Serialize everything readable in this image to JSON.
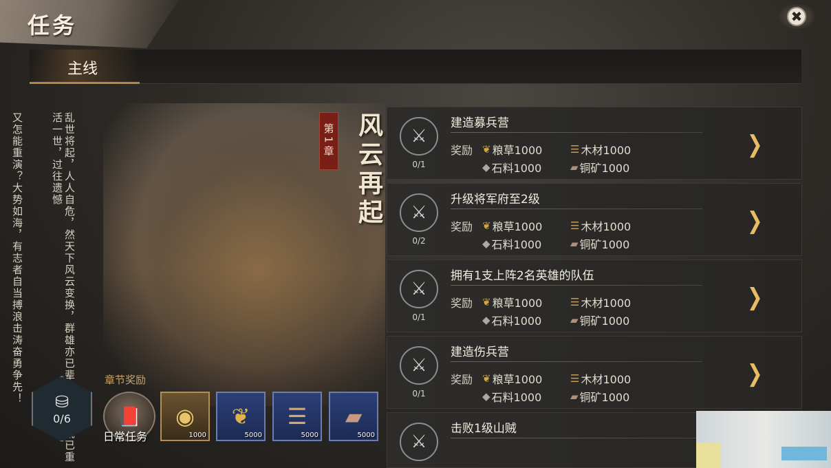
{
  "header": {
    "title": "任务",
    "close_label": "✖"
  },
  "tabs": [
    {
      "label": "主线",
      "active": true
    }
  ],
  "story": {
    "col1": "乱世将起，人人自危，然天下风云变换，群雄亦已辈出，而今既已重活一世，过往遗憾",
    "col2": "又怎能重演？大势如海，有志者自当搏浪击涛奋勇争先！"
  },
  "chapter": {
    "tag": "第1章",
    "title": "风云再起"
  },
  "progress": {
    "value": "0/6"
  },
  "chapter_rewards": {
    "label": "章节奖励",
    "daily_label": "日常任务",
    "items": [
      {
        "icon": "gold-coin-icon",
        "amount": "1000"
      },
      {
        "icon": "grain-icon",
        "amount": "5000"
      },
      {
        "icon": "wood-icon",
        "amount": "5000"
      },
      {
        "icon": "copper-ingot-icon",
        "amount": "5000"
      }
    ]
  },
  "quests": [
    {
      "title": "建造募兵营",
      "progress": "0/1",
      "reward_label": "奖励",
      "rewards": [
        "粮草1000",
        "木材1000",
        "石料1000",
        "铜矿1000"
      ]
    },
    {
      "title": "升级将军府至2级",
      "progress": "0/2",
      "reward_label": "奖励",
      "rewards": [
        "粮草1000",
        "木材1000",
        "石料1000",
        "铜矿1000"
      ]
    },
    {
      "title": "拥有1支上阵2名英雄的队伍",
      "progress": "0/1",
      "reward_label": "奖励",
      "rewards": [
        "粮草1000",
        "木材1000",
        "石料1000",
        "铜矿1000"
      ]
    },
    {
      "title": "建造伤兵营",
      "progress": "0/1",
      "reward_label": "奖励",
      "rewards": [
        "粮草1000",
        "木材1000",
        "石料1000",
        "铜矿1000"
      ]
    },
    {
      "title": "击败1级山贼",
      "progress": "",
      "reward_label": "",
      "rewards": []
    }
  ],
  "colors": {
    "accent_gold": "#e6bd62",
    "chapter_red": "#7a1f17",
    "panel": "#2d2c2a"
  }
}
